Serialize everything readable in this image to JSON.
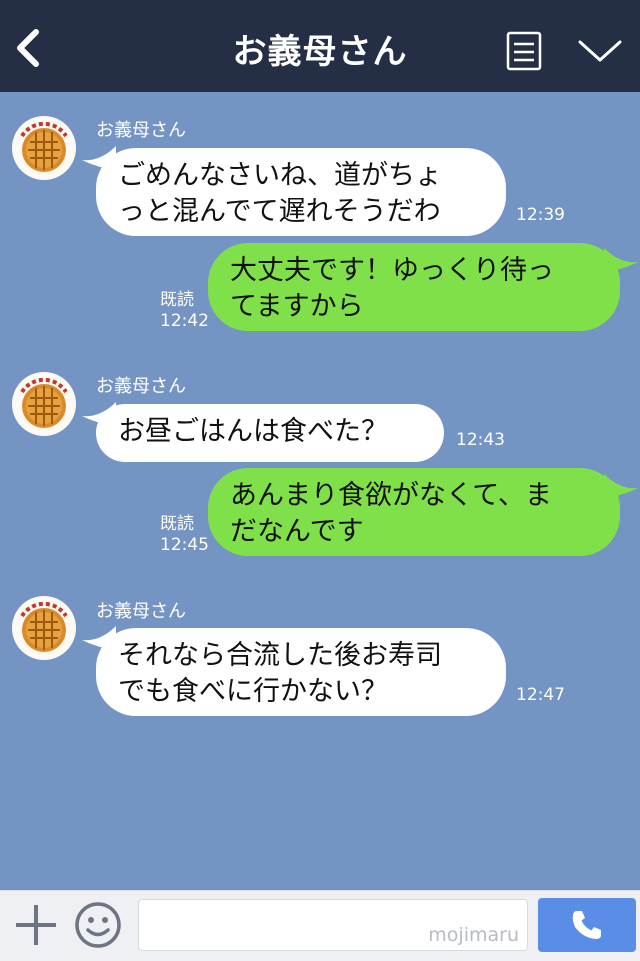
{
  "header": {
    "title": "お義母さん",
    "back_icon": "chevron-left-icon",
    "menu_icon": "notes-icon",
    "dropdown_icon": "chevron-down-icon"
  },
  "messages": [
    {
      "sender": "お義母さん",
      "text": "ごめんなさいね、道がちょ\nっと混んでて遅れそうだわ",
      "time": "12:39"
    },
    {
      "read": "既読",
      "time": "12:42",
      "text": "大丈夫です！ゆっくり待っ\nてますから"
    },
    {
      "sender": "お義母さん",
      "text": "お昼ごはんは食べた？",
      "time": "12:43"
    },
    {
      "read": "既読",
      "time": "12:45",
      "text": "あんまり食欲がなくて、ま\nだなんです"
    },
    {
      "sender": "お義母さん",
      "text": "それなら合流した後お寿司\nでも食べに行かない？",
      "time": "12:47"
    }
  ],
  "input": {
    "watermark": "mojimaru"
  },
  "colors": {
    "header_bg": "#242e45",
    "chat_bg": "#7494c4",
    "incoming_bubble": "#ffffff",
    "outgoing_bubble": "#80e04a",
    "call_button": "#5a8ee6"
  }
}
